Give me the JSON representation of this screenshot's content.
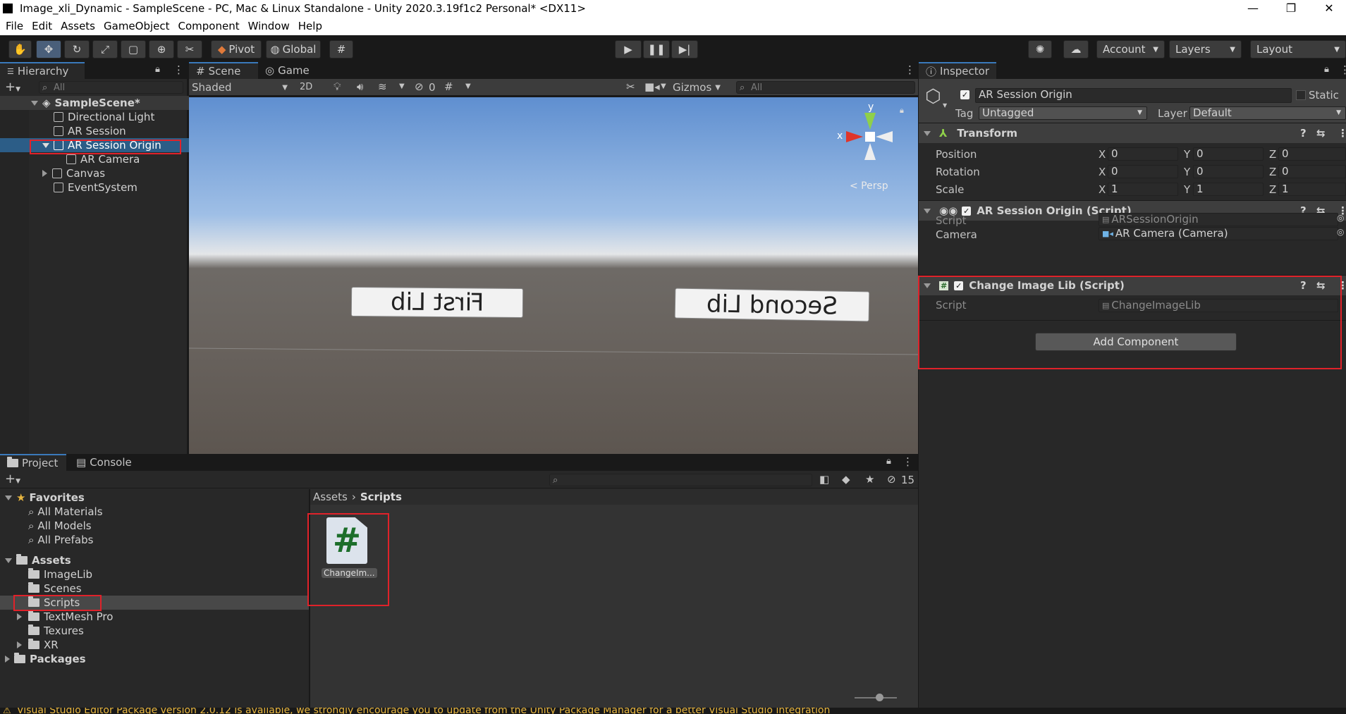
{
  "window": {
    "title": "Image_xli_Dynamic - SampleScene - PC, Mac & Linux Standalone - Unity 2020.3.19f1c2 Personal* <DX11>",
    "minimize": "—",
    "restore": "❐",
    "close": "✕"
  },
  "menu": [
    "File",
    "Edit",
    "Assets",
    "GameObject",
    "Component",
    "Window",
    "Help"
  ],
  "toolbar": {
    "pivot": "Pivot",
    "global": "Global",
    "account": "Account",
    "layers": "Layers",
    "layout": "Layout"
  },
  "hierarchy": {
    "tab": "Hierarchy",
    "search_placeholder": "All",
    "scene": "SampleScene*",
    "items": [
      "Directional Light",
      "AR Session",
      "AR Session Origin",
      "AR Camera",
      "Canvas",
      "EventSystem"
    ]
  },
  "scene": {
    "tab_scene": "Scene",
    "tab_game": "Game",
    "shading": "Shaded",
    "mode_2d": "2D",
    "hidden_count": "0",
    "gizmos": "Gizmos",
    "search_placeholder": "All",
    "gizmo_x": "x",
    "gizmo_y": "y",
    "persp": "< Persp",
    "label1": "First Lib",
    "label2": "Second Lib"
  },
  "inspector": {
    "tab": "Inspector",
    "object_name": "AR Session Origin",
    "static_label": "Static",
    "tag_label": "Tag",
    "tag_value": "Untagged",
    "layer_label": "Layer",
    "layer_value": "Default",
    "transform": {
      "title": "Transform",
      "position_label": "Position",
      "rotation_label": "Rotation",
      "scale_label": "Scale",
      "position": [
        "0",
        "0",
        "0"
      ],
      "rotation": [
        "0",
        "0",
        "0"
      ],
      "scale": [
        "1",
        "1",
        "1"
      ],
      "axis": [
        "X",
        "Y",
        "Z"
      ]
    },
    "ar_origin": {
      "title": "AR Session Origin (Script)",
      "script_label": "Script",
      "script_value": "ARSessionOrigin",
      "camera_label": "Camera",
      "camera_value": "AR Camera (Camera)"
    },
    "change_lib": {
      "title": "Change Image Lib (Script)",
      "script_label": "Script",
      "script_value": "ChangeImageLib"
    },
    "add_component": "Add Component"
  },
  "project": {
    "tab_project": "Project",
    "tab_console": "Console",
    "hidden_count": "15",
    "favorites": "Favorites",
    "fav_items": [
      "All Materials",
      "All Models",
      "All Prefabs"
    ],
    "assets": "Assets",
    "asset_folders": [
      "ImageLib",
      "Scenes",
      "Scripts",
      "TextMesh Pro",
      "Texures",
      "XR"
    ],
    "packages": "Packages",
    "breadcrumb_root": "Assets",
    "breadcrumb_current": "Scripts",
    "file_name": "ChangeIm...",
    "file_glyph": "#"
  },
  "status": {
    "message": "Visual Studio Editor Package version 2.0.12 is available, we strongly encourage you to update from the Unity Package Manager for a better Visual Studio integration"
  }
}
